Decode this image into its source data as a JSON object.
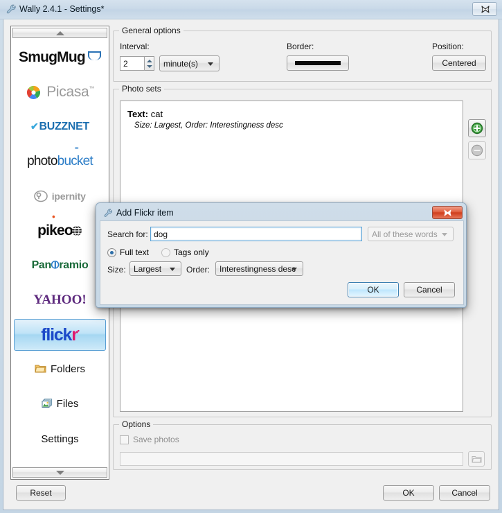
{
  "window": {
    "title": "Wally 2.4.1 - Settings*",
    "title_icon": "wrench-icon",
    "close_label": "X"
  },
  "sidebar": {
    "scroll_up": "scroll-up-arrow",
    "scroll_down": "scroll-down-arrow",
    "items": [
      {
        "id": "smugmug",
        "label": "SmugMug",
        "type": "logo"
      },
      {
        "id": "picasa",
        "label": "Picasa",
        "type": "logo"
      },
      {
        "id": "buzznet",
        "label": "BUZZNET",
        "type": "logo"
      },
      {
        "id": "photobucket",
        "label": "photobucket",
        "type": "logo"
      },
      {
        "id": "ipernity",
        "label": "ipernity",
        "type": "logo"
      },
      {
        "id": "pikeo",
        "label": "pikeo",
        "type": "logo"
      },
      {
        "id": "panoramio",
        "label": "Panoramio",
        "type": "logo"
      },
      {
        "id": "yahoo",
        "label": "YAHOO!",
        "type": "logo"
      },
      {
        "id": "flickr",
        "label": "flickr",
        "type": "logo",
        "selected": true
      },
      {
        "id": "folders",
        "label": "Folders",
        "type": "text",
        "icon": "folder-icon"
      },
      {
        "id": "files",
        "label": "Files",
        "type": "text",
        "icon": "files-icon"
      },
      {
        "id": "settings",
        "label": "Settings",
        "type": "text"
      }
    ]
  },
  "general_options": {
    "group_title": "General options",
    "interval_label": "Interval:",
    "interval_value": "2",
    "interval_unit": "minute(s)",
    "border_label": "Border:",
    "border_value": "solid-thick-black-bar",
    "position_label": "Position:",
    "position_value": "Centered"
  },
  "photo_sets": {
    "group_title": "Photo sets",
    "add_icon": "plus-circle-icon",
    "remove_icon": "minus-circle-icon",
    "items": [
      {
        "label_prefix": "Text:",
        "label_value": "cat",
        "detail": "Size: Largest,  Order: Interestingness desc"
      }
    ]
  },
  "options": {
    "group_title": "Options",
    "save_photos_label": "Save photos",
    "save_photos_checked": false,
    "path_value": "",
    "browse_icon": "folder-open-icon"
  },
  "footer": {
    "reset_label": "Reset",
    "ok_label": "OK",
    "cancel_label": "Cancel"
  },
  "dialog": {
    "title": "Add Flickr item",
    "title_icon": "wrench-icon",
    "close_label": "X",
    "search_label": "Search for:",
    "search_value": "dog",
    "search_placeholder": "",
    "match_mode": "All of these words",
    "radio_full_text": "Full text",
    "radio_tags_only": "Tags only",
    "radio_selected": "full_text",
    "size_label": "Size:",
    "size_value": "Largest",
    "order_label": "Order:",
    "order_value": "Interestingness desc",
    "ok_label": "OK",
    "cancel_label": "Cancel"
  },
  "colors": {
    "accent": "#3c7fb1",
    "window_chrome": "#cfdde9",
    "panel": "#f0f0f0",
    "flickr_blue": "#1c49c9",
    "flickr_pink": "#e0176d"
  }
}
